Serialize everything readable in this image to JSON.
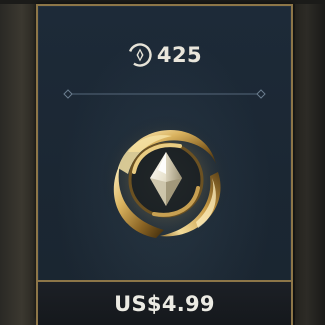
{
  "offer": {
    "currency_icon": "riot-points-icon",
    "amount": "425",
    "emblem_icon": "gold-crystal-emblem-icon",
    "price": "US$4.99"
  },
  "colors": {
    "frame_gold": "#8d7648",
    "card_navy": "#1d2a38",
    "text_light": "#e9e6dc"
  }
}
